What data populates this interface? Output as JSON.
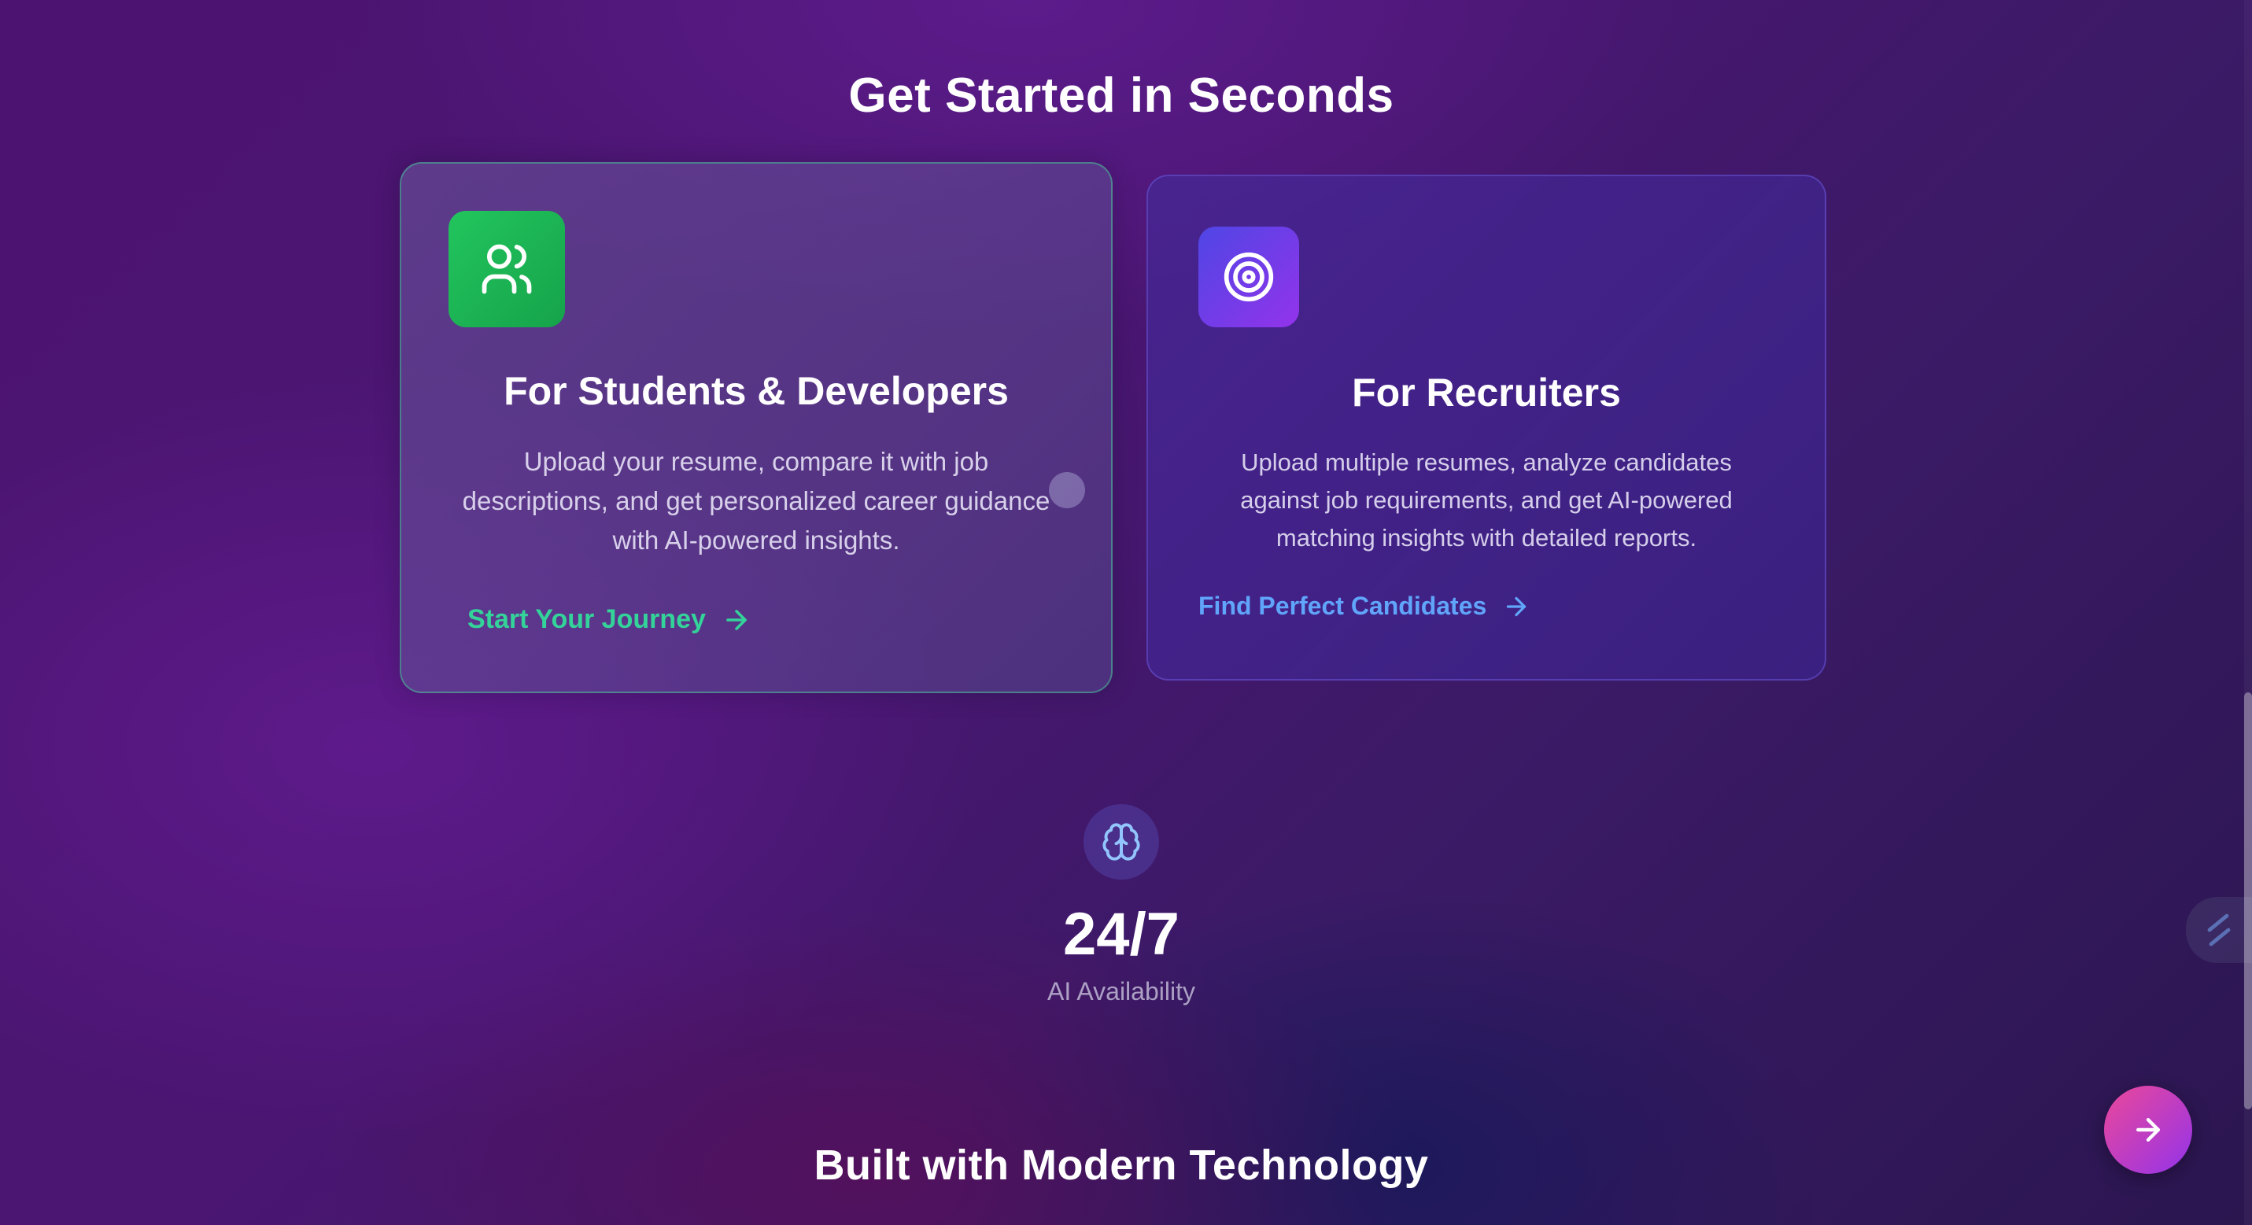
{
  "section": {
    "title": "Get Started in Seconds"
  },
  "cards": {
    "students": {
      "icon": "users-icon",
      "title": "For Students & Developers",
      "description": "Upload your resume, compare it with job descriptions, and get personalized career guidance with AI-powered insights.",
      "link_label": "Start Your Journey",
      "accent": "#22c55e"
    },
    "recruiters": {
      "icon": "target-icon",
      "title": "For Recruiters",
      "description": "Upload multiple resumes, analyze candidates against job requirements, and get AI-powered matching insights with detailed reports.",
      "link_label": "Find Perfect Candidates",
      "accent": "#60a5fa"
    }
  },
  "stat": {
    "icon": "brain-icon",
    "value": "24/7",
    "label": "AI Availability"
  },
  "next_section": {
    "title": "Built with Modern Technology"
  },
  "fab": {
    "icon": "arrow-right-icon",
    "accent": "#ec4899"
  }
}
